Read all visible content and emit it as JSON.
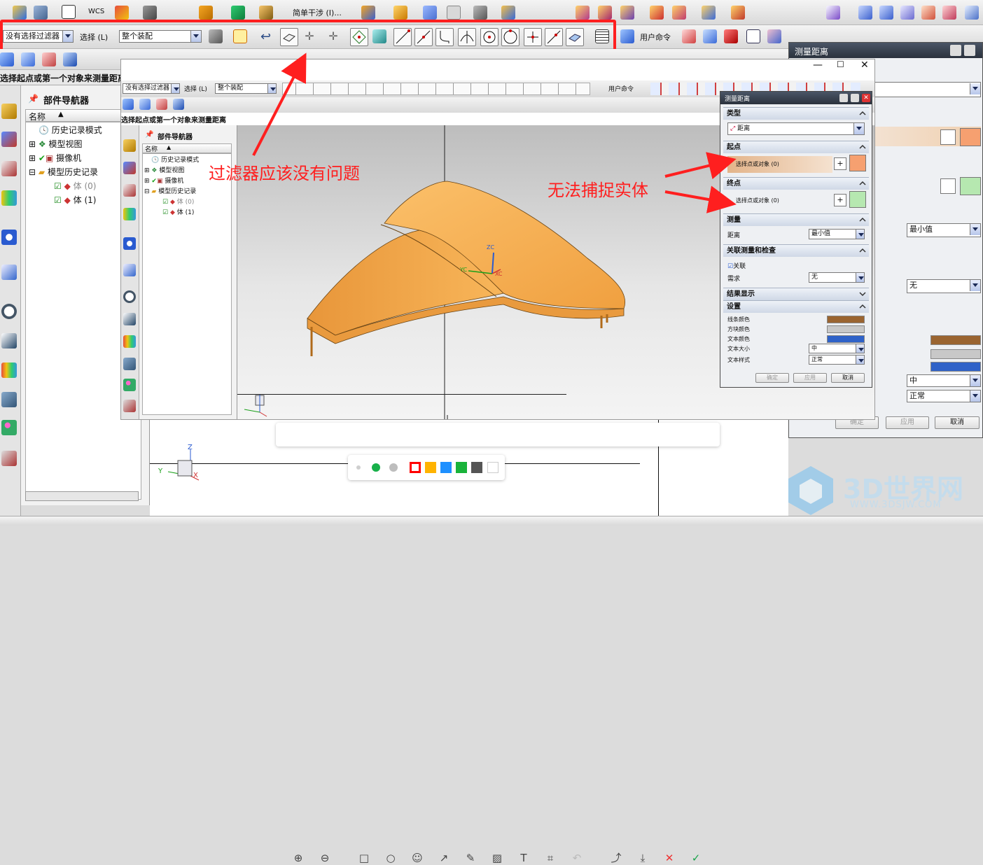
{
  "main_toolbar": {
    "filter_value": "没有选择过滤器",
    "select_label": "选择 (L)",
    "scope_value": "整个装配",
    "user_command": "用户命令",
    "wcs_label": "WCS",
    "interference_label": "简单干涉 (I)..."
  },
  "status": {
    "prompt": "选择起点或第一个对象来测量距离"
  },
  "navigator": {
    "title": "部件导航器",
    "column_name": "名称",
    "items": [
      {
        "label": "历史记录模式"
      },
      {
        "label": "模型视图"
      },
      {
        "label": "摄像机"
      },
      {
        "label": "模型历史记录"
      },
      {
        "label": "体 (0)"
      },
      {
        "label": "体 (1)"
      }
    ]
  },
  "inner_navigator": {
    "title": "部件导航器",
    "column_name": "名称",
    "items": [
      {
        "label": "历史记录模式"
      },
      {
        "label": "模型视图"
      },
      {
        "label": "摄像机"
      },
      {
        "label": "模型历史记录"
      },
      {
        "label": "体 (0)"
      },
      {
        "label": "体 (1)"
      }
    ]
  },
  "inner_toolbar": {
    "filter_value": "没有选择过滤器",
    "select_label": "选择 (L)",
    "scope_value": "整个装配",
    "user_command": "用户命令",
    "prompt": "选择起点或第一个对象来测量距离"
  },
  "dialog": {
    "title": "测量距离",
    "sections": {
      "type": "类型",
      "start": "起点",
      "end": "终点",
      "measure": "测量",
      "assoc": "关联测量和检查",
      "results": "结果显示",
      "settings": "设置"
    },
    "type_value": "距离",
    "start_prompt": "选择点或对象 (0)",
    "end_prompt": "选择点或对象 (0)",
    "distance_label": "距离",
    "distance_value": "最小值",
    "assoc_checkbox": "关联",
    "need_label": "需求",
    "need_value": "无",
    "line_color_label": "线条颜色",
    "block_color_label": "方块颜色",
    "text_color_label": "文本颜色",
    "text_size_label": "文本大小",
    "text_size_value": "中",
    "text_style_label": "文本样式",
    "text_style_value": "正常",
    "ok": "确定",
    "apply": "应用",
    "cancel": "取消"
  },
  "back_dialog": {
    "title": "测量距离",
    "distance_value": "最小值",
    "need_value": "无",
    "text_size_value": "中",
    "text_style_value": "正常",
    "ok": "确定",
    "apply": "应用",
    "cancel": "取消"
  },
  "annotations": {
    "filter_note": "过滤器应该没有问题",
    "snap_note": "无法捕捉实体"
  },
  "axes": {
    "zc": "ZC",
    "yc": "YC",
    "xc": "XC",
    "z": "Z",
    "y": "Y",
    "x": "X"
  },
  "watermark": {
    "brand": "3D世界网",
    "url": "WWW.3DSJW.COM"
  },
  "colors": {
    "annotation_red": "#ff1f1f",
    "model_orange": "#f5a94a",
    "line_color": "#9a6430",
    "block_color": "#c8c8c8",
    "text_color": "#2f62c8"
  },
  "palette": [
    "#cfcfcf",
    "#18b04a",
    "#bdbdbd",
    "#ff0000",
    "#ffb300",
    "#1e90ff",
    "#19b33a",
    "#555555",
    "#ffffff"
  ]
}
